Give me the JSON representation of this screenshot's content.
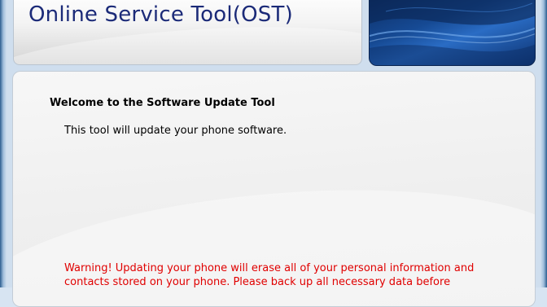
{
  "header": {
    "title": "Online Service Tool(OST)"
  },
  "content": {
    "heading": "Welcome to the Software Update Tool",
    "description": "This tool will update your phone software.",
    "warning": "Warning! Updating your phone will erase all of your personal information and contacts stored on your phone. Please back up all necessary data before"
  },
  "colors": {
    "title": "#1b2a78",
    "warning": "#e00000",
    "banner": "#164a94"
  }
}
